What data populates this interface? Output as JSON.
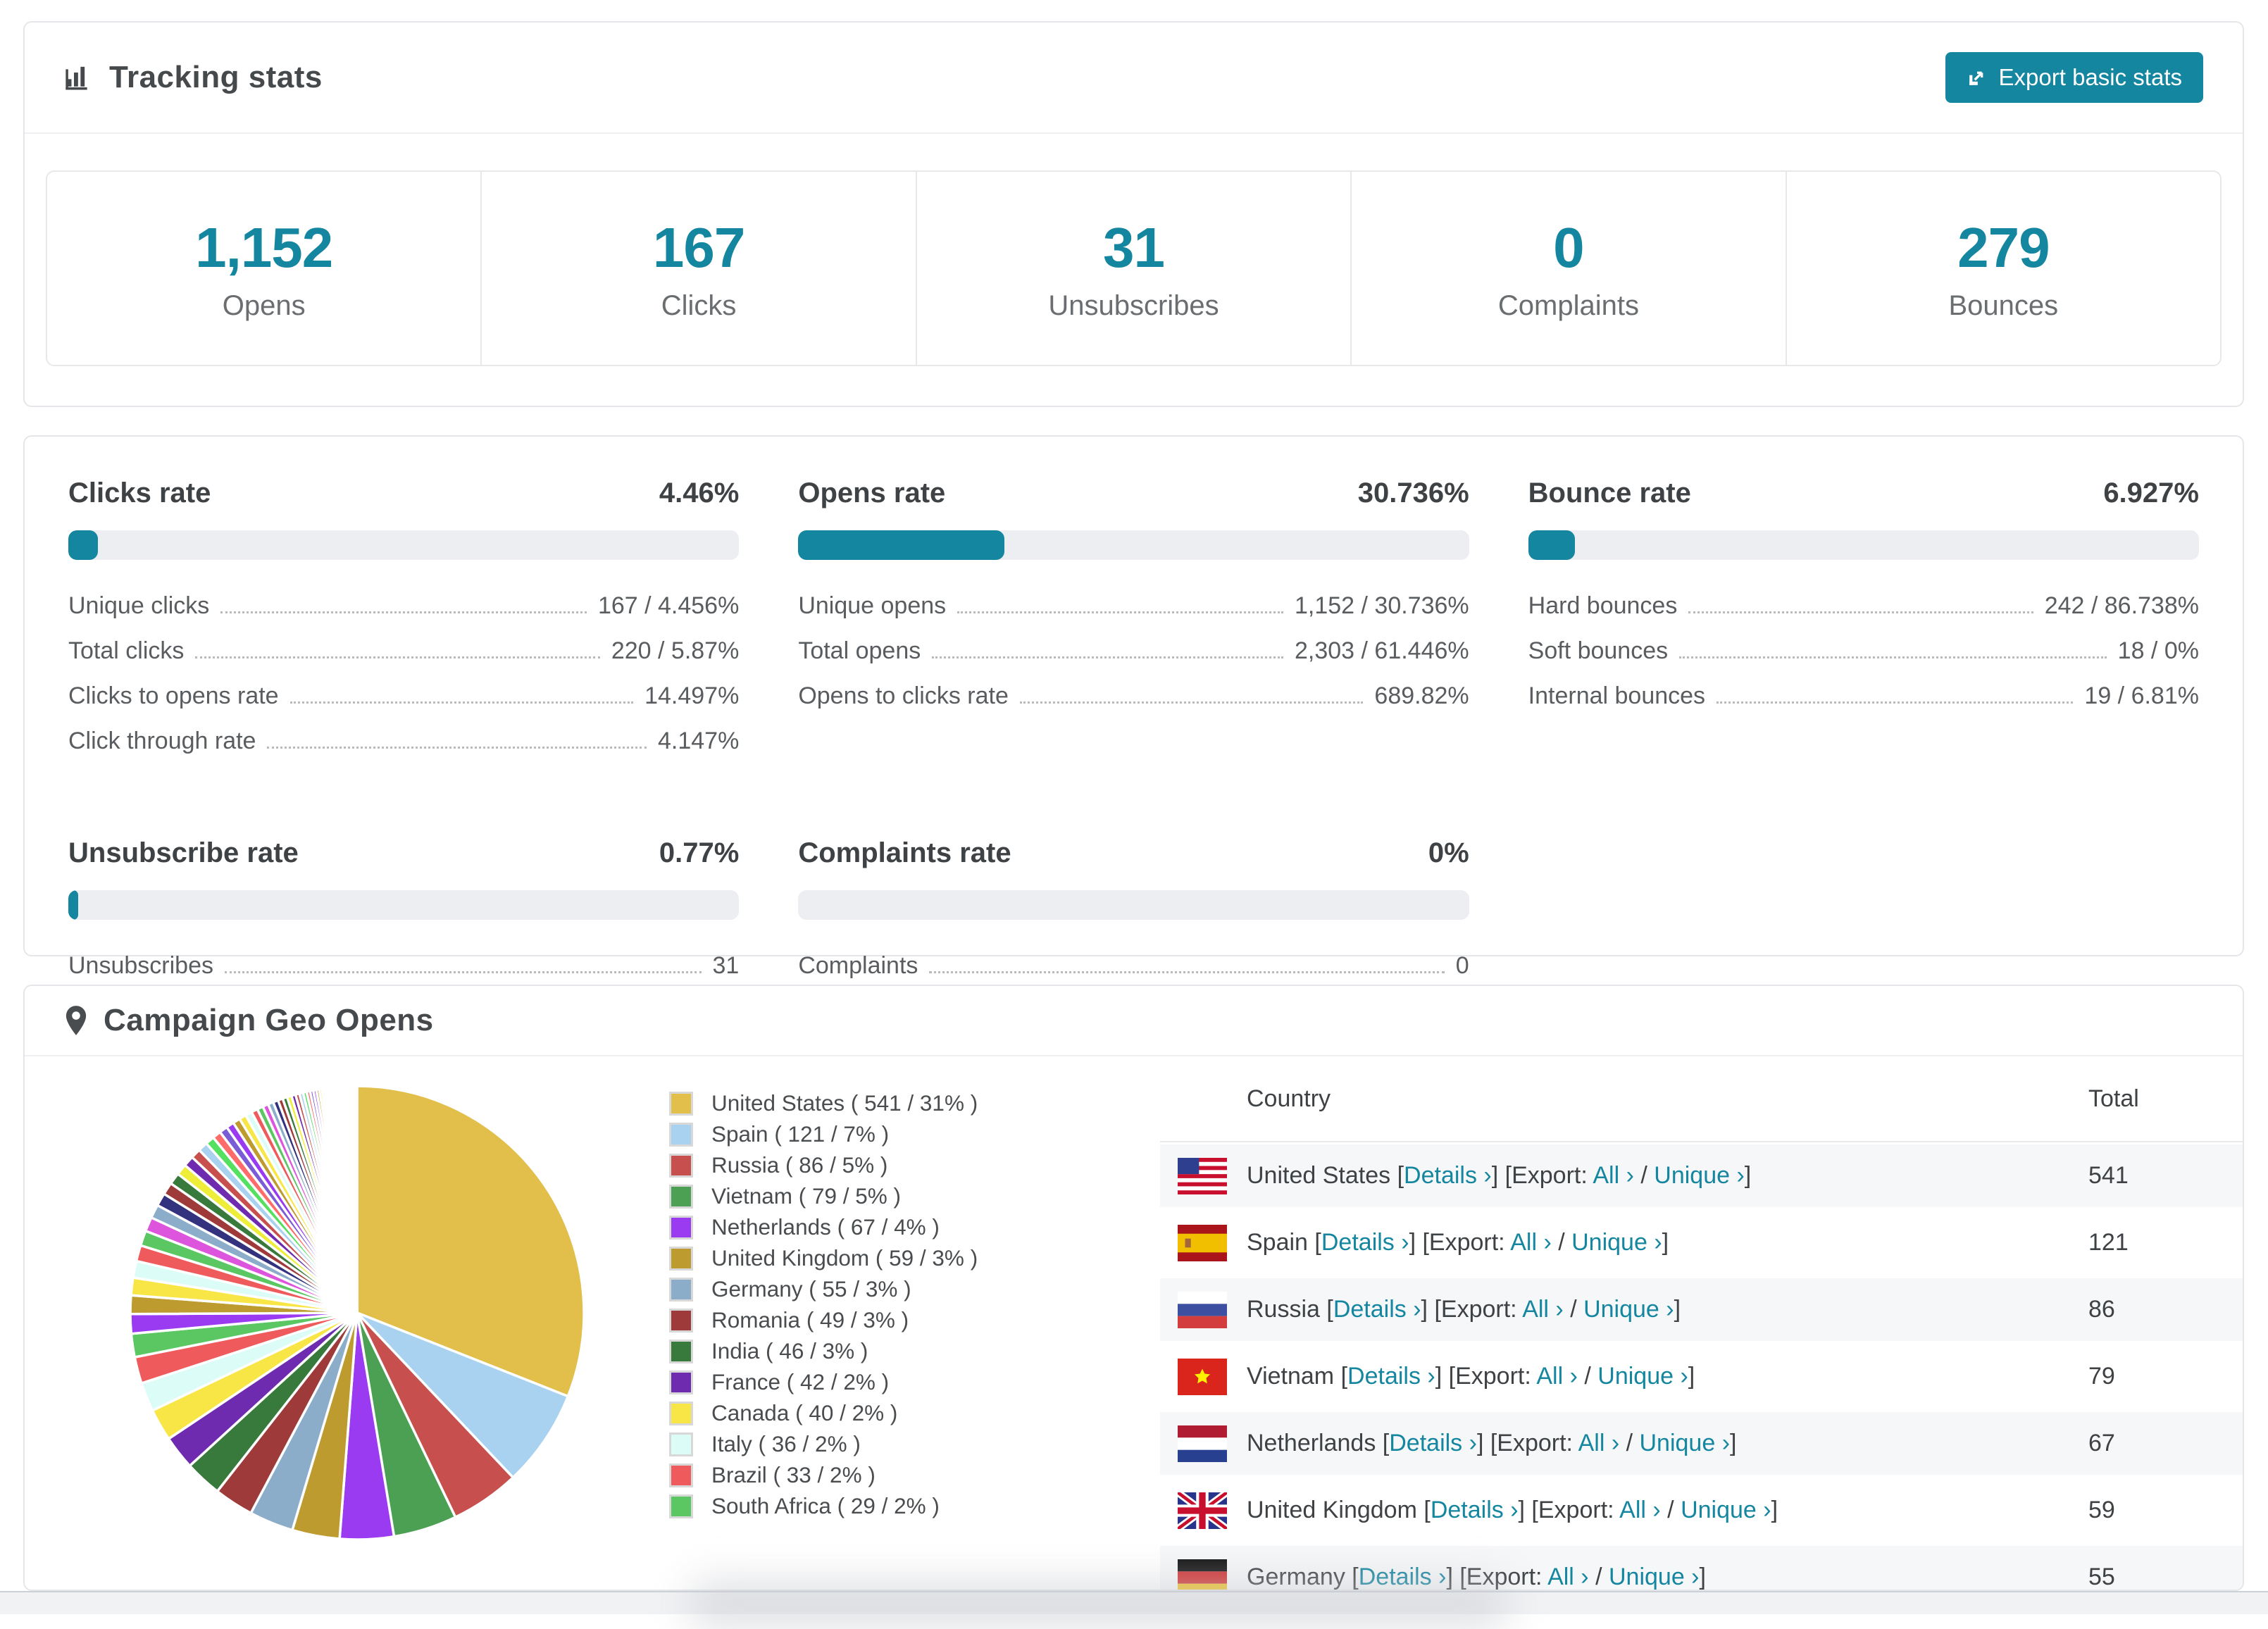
{
  "colors": {
    "accent": "#1586a0",
    "bar_track": "#eceef2",
    "card_border": "#e4e6e9",
    "row_stripe": "#f6f7f8",
    "text_dark": "#3f4245"
  },
  "tracking": {
    "title": "Tracking stats",
    "export_button": {
      "label": "Export basic stats"
    },
    "stats": [
      {
        "value": "1,152",
        "label": "Opens"
      },
      {
        "value": "167",
        "label": "Clicks"
      },
      {
        "value": "31",
        "label": "Unsubscribes"
      },
      {
        "value": "0",
        "label": "Complaints"
      },
      {
        "value": "279",
        "label": "Bounces"
      }
    ]
  },
  "rates": {
    "blocks": [
      {
        "title": "Clicks rate",
        "value": "4.46%",
        "percent": 4.46,
        "rows": [
          {
            "label": "Unique clicks",
            "value": "167 / 4.456%"
          },
          {
            "label": "Total clicks",
            "value": "220 / 5.87%"
          },
          {
            "label": "Clicks to opens rate",
            "value": "14.497%"
          },
          {
            "label": "Click through rate",
            "value": "4.147%"
          }
        ]
      },
      {
        "title": "Opens rate",
        "value": "30.736%",
        "percent": 30.736,
        "rows": [
          {
            "label": "Unique opens",
            "value": "1,152 / 30.736%"
          },
          {
            "label": "Total opens",
            "value": "2,303 / 61.446%"
          },
          {
            "label": "Opens to clicks rate",
            "value": "689.82%"
          }
        ]
      },
      {
        "title": "Bounce rate",
        "value": "6.927%",
        "percent": 6.927,
        "rows": [
          {
            "label": "Hard bounces",
            "value": "242 / 86.738%"
          },
          {
            "label": "Soft bounces",
            "value": "18 / 0%"
          },
          {
            "label": "Internal bounces",
            "value": "19 / 6.81%"
          }
        ]
      },
      {
        "title": "Unsubscribe rate",
        "value": "0.77%",
        "percent": 0.77,
        "rows": [
          {
            "label": "Unsubscribes",
            "value": "31"
          }
        ]
      },
      {
        "title": "Complaints rate",
        "value": "0%",
        "percent": 0,
        "rows": [
          {
            "label": "Complaints",
            "value": "0"
          }
        ]
      }
    ]
  },
  "geo": {
    "title": "Campaign Geo Opens",
    "chart_data": {
      "type": "pie",
      "title": "Campaign Geo Opens",
      "unit": "opens",
      "legend_position": "right",
      "start_angle_deg": -90,
      "direction": "clockwise",
      "total_opens_approx": 1745,
      "series": [
        {
          "name": "United States",
          "value": 541,
          "pct": "31%",
          "color": "#e2bf4a"
        },
        {
          "name": "Spain",
          "value": 121,
          "pct": "7%",
          "color": "#a8d2f0"
        },
        {
          "name": "Russia",
          "value": 86,
          "pct": "5%",
          "color": "#c74f4e"
        },
        {
          "name": "Vietnam",
          "value": 79,
          "pct": "5%",
          "color": "#4ca053"
        },
        {
          "name": "Netherlands",
          "value": 67,
          "pct": "4%",
          "color": "#9a3bf2"
        },
        {
          "name": "United Kingdom",
          "value": 59,
          "pct": "3%",
          "color": "#bd9b2e"
        },
        {
          "name": "Germany",
          "value": 55,
          "pct": "3%",
          "color": "#8badc9"
        },
        {
          "name": "Romania",
          "value": 49,
          "pct": "3%",
          "color": "#9e3a39"
        },
        {
          "name": "India",
          "value": 46,
          "pct": "3%",
          "color": "#377a3b"
        },
        {
          "name": "France",
          "value": 42,
          "pct": "2%",
          "color": "#6e2bb0"
        },
        {
          "name": "Canada",
          "value": 40,
          "pct": "2%",
          "color": "#f8e647"
        },
        {
          "name": "Italy",
          "value": 36,
          "pct": "2%",
          "color": "#dcfcf8"
        },
        {
          "name": "Brazil",
          "value": 33,
          "pct": "2%",
          "color": "#ef5a5c"
        },
        {
          "name": "South Africa",
          "value": 29,
          "pct": "2%",
          "color": "#5bc762"
        }
      ],
      "others_unlabeled": {
        "total": 462,
        "slices": 60,
        "decay": 0.95,
        "first_value": 24
      },
      "legend_format": "{name} ( {value} / {pct} )"
    },
    "table": {
      "columns": [
        "Country",
        "Total"
      ],
      "link_labels": {
        "details": "Details",
        "export": "Export:",
        "all": "All",
        "unique": "Unique",
        "chevron": "›"
      },
      "rows": [
        {
          "country": "United States",
          "flag": "us",
          "total": "541"
        },
        {
          "country": "Spain",
          "flag": "es",
          "total": "121"
        },
        {
          "country": "Russia",
          "flag": "ru",
          "total": "86"
        },
        {
          "country": "Vietnam",
          "flag": "vn",
          "total": "79"
        },
        {
          "country": "Netherlands",
          "flag": "nl",
          "total": "67"
        },
        {
          "country": "United Kingdom",
          "flag": "gb",
          "total": "59"
        },
        {
          "country": "Germany",
          "flag": "de",
          "total": "55"
        }
      ]
    }
  }
}
